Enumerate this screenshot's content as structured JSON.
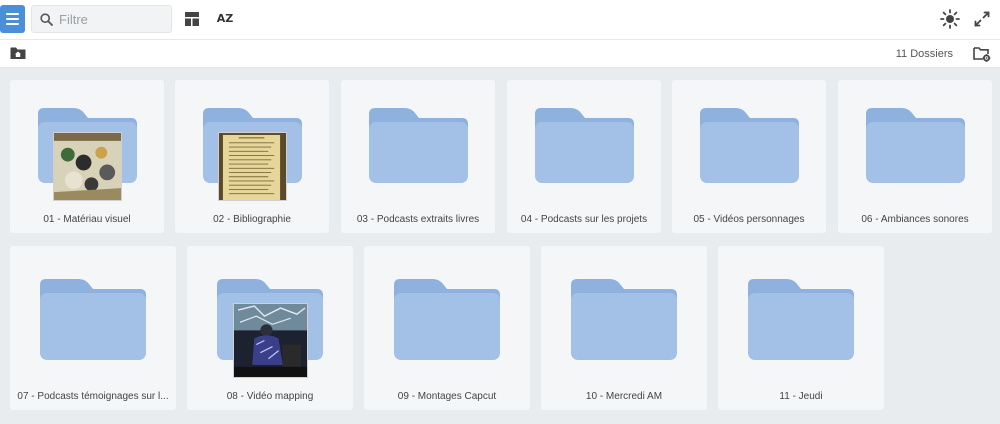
{
  "toolbar": {
    "menu_icon": "hamburger-menu-icon",
    "search_placeholder": "Filtre",
    "layout_icon": "layout-icon",
    "sort_label": "AZ",
    "theme_icon": "sun-icon",
    "fullscreen_icon": "fullscreen-icon"
  },
  "subbar": {
    "home_icon": "home-folder-icon",
    "count_text": "11 Dossiers",
    "settings_icon": "folder-settings-icon"
  },
  "colors": {
    "accent": "#4a90d9",
    "folder_back": "#8eb2dd",
    "folder_front": "#a3c1e6",
    "tile_bg": "#f5f6f8",
    "page_bg": "#e9ecef"
  },
  "folders": [
    {
      "name": "01 - Matériau visuel",
      "thumbnail": "collage-thumbnail"
    },
    {
      "name": "02 - Bibliographie",
      "thumbnail": "book-page-thumbnail"
    },
    {
      "name": "03 - Podcasts extraits livres",
      "thumbnail": ""
    },
    {
      "name": "04 - Podcasts sur les projets",
      "thumbnail": ""
    },
    {
      "name": "05 - Vidéos personnages",
      "thumbnail": ""
    },
    {
      "name": "06 - Ambiances sonores",
      "thumbnail": ""
    },
    {
      "name": "07 - Podcasts témoignages sur l...",
      "thumbnail": ""
    },
    {
      "name": "08 - Vidéo mapping",
      "thumbnail": "projection-thumbnail"
    },
    {
      "name": "09 - Montages Capcut",
      "thumbnail": ""
    },
    {
      "name": "10 - Mercredi AM",
      "thumbnail": ""
    },
    {
      "name": "11 - Jeudi",
      "thumbnail": ""
    }
  ]
}
